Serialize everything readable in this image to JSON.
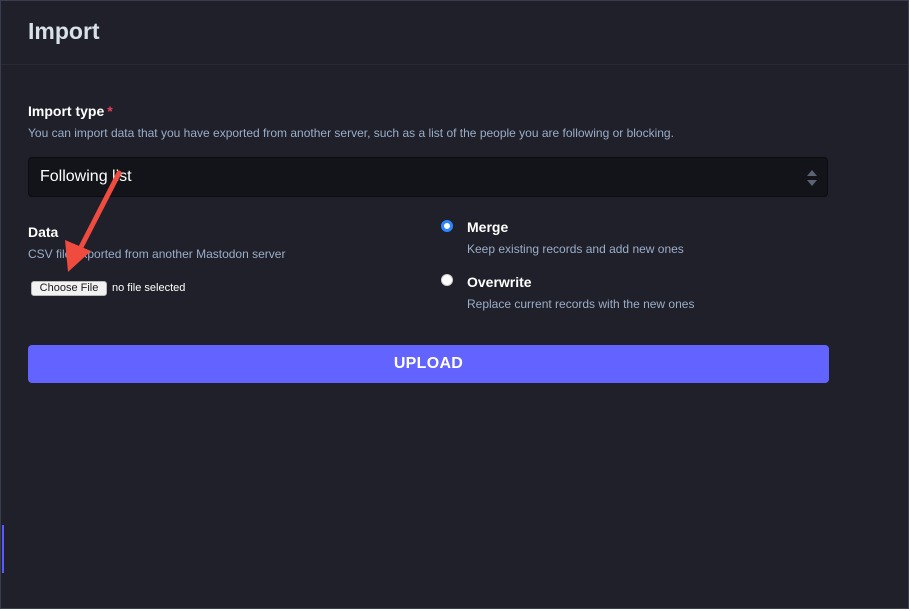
{
  "page": {
    "title": "Import"
  },
  "import_type": {
    "label": "Import type",
    "required_marker": "*",
    "hint": "You can import data that you have exported from another server, such as a list of the people you are following or blocking.",
    "selected_value": "Following list"
  },
  "data_field": {
    "label": "Data",
    "hint": "CSV file exported from another Mastodon server",
    "file_button_label": "Choose File",
    "file_status": "no file selected"
  },
  "mode": {
    "options": [
      {
        "label": "Merge",
        "hint": "Keep existing records and add new ones",
        "checked": true
      },
      {
        "label": "Overwrite",
        "hint": "Replace current records with the new ones",
        "checked": false
      }
    ]
  },
  "actions": {
    "upload_label": "UPLOAD"
  },
  "colors": {
    "background": "#1f2029",
    "accent": "#6364ff",
    "required": "#df405a",
    "annotation_arrow": "#ef4b3f"
  }
}
